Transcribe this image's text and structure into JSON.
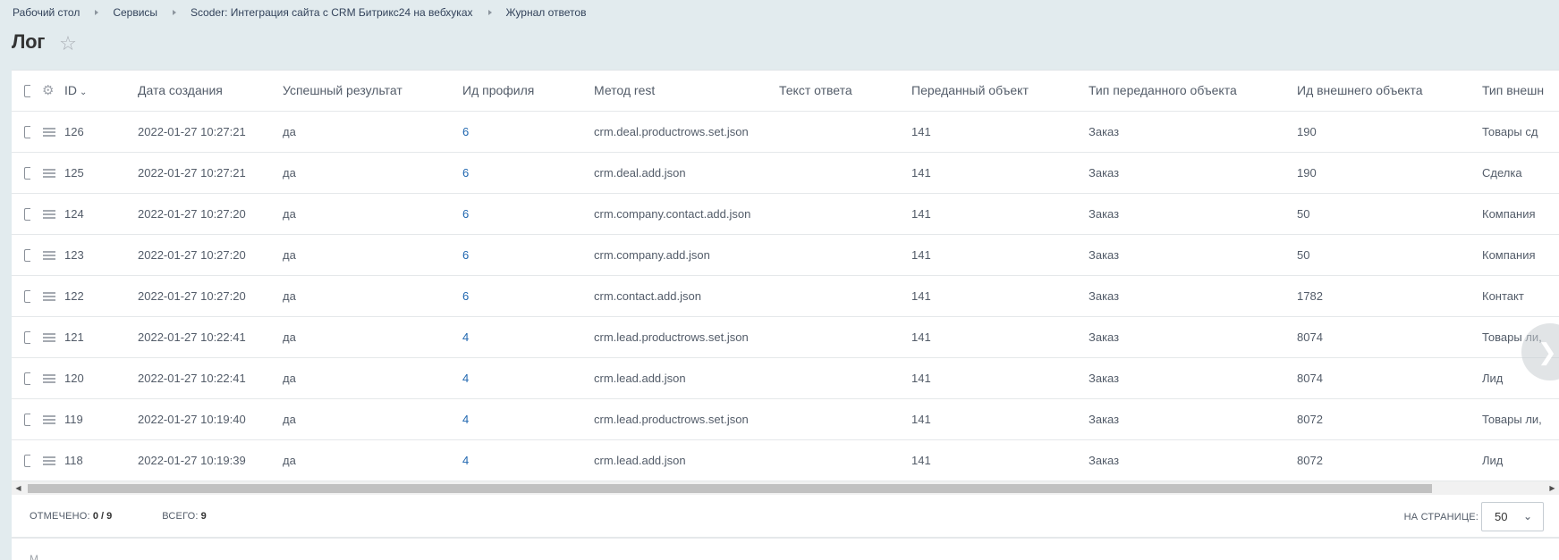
{
  "breadcrumb": [
    "Рабочий стол",
    "Сервисы",
    "Scoder: Интеграция сайта с CRM Битрикс24 на вебхуках",
    "Журнал ответов"
  ],
  "page_title": "Лог",
  "columns": {
    "id": "ID",
    "date": "Дата создания",
    "result": "Успешный результат",
    "profile": "Ид профиля",
    "method": "Метод rest",
    "text": "Текст ответа",
    "object": "Переданный объект",
    "object_type": "Тип переданного объекта",
    "external_id": "Ид внешнего объекта",
    "external_type": "Тип внешн"
  },
  "rows": [
    {
      "id": "126",
      "date": "2022-01-27 10:27:21",
      "result": "да",
      "profile": "6",
      "method": "crm.deal.productrows.set.json",
      "text": "",
      "object": "141",
      "object_type": "Заказ",
      "external_id": "190",
      "external_type": "Товары сд"
    },
    {
      "id": "125",
      "date": "2022-01-27 10:27:21",
      "result": "да",
      "profile": "6",
      "method": "crm.deal.add.json",
      "text": "",
      "object": "141",
      "object_type": "Заказ",
      "external_id": "190",
      "external_type": "Сделка"
    },
    {
      "id": "124",
      "date": "2022-01-27 10:27:20",
      "result": "да",
      "profile": "6",
      "method": "crm.company.contact.add.json",
      "text": "",
      "object": "141",
      "object_type": "Заказ",
      "external_id": "50",
      "external_type": "Компания"
    },
    {
      "id": "123",
      "date": "2022-01-27 10:27:20",
      "result": "да",
      "profile": "6",
      "method": "crm.company.add.json",
      "text": "",
      "object": "141",
      "object_type": "Заказ",
      "external_id": "50",
      "external_type": "Компания"
    },
    {
      "id": "122",
      "date": "2022-01-27 10:27:20",
      "result": "да",
      "profile": "6",
      "method": "crm.contact.add.json",
      "text": "",
      "object": "141",
      "object_type": "Заказ",
      "external_id": "1782",
      "external_type": "Контакт"
    },
    {
      "id": "121",
      "date": "2022-01-27 10:22:41",
      "result": "да",
      "profile": "4",
      "method": "crm.lead.productrows.set.json",
      "text": "",
      "object": "141",
      "object_type": "Заказ",
      "external_id": "8074",
      "external_type": "Товары ли,"
    },
    {
      "id": "120",
      "date": "2022-01-27 10:22:41",
      "result": "да",
      "profile": "4",
      "method": "crm.lead.add.json",
      "text": "",
      "object": "141",
      "object_type": "Заказ",
      "external_id": "8074",
      "external_type": "Лид"
    },
    {
      "id": "119",
      "date": "2022-01-27 10:19:40",
      "result": "да",
      "profile": "4",
      "method": "crm.lead.productrows.set.json",
      "text": "",
      "object": "141",
      "object_type": "Заказ",
      "external_id": "8072",
      "external_type": "Товары ли,"
    },
    {
      "id": "118",
      "date": "2022-01-27 10:19:39",
      "result": "да",
      "profile": "4",
      "method": "crm.lead.add.json",
      "text": "",
      "object": "141",
      "object_type": "Заказ",
      "external_id": "8072",
      "external_type": "Лид"
    }
  ],
  "footer": {
    "checked_label": "Отмечено:",
    "checked_value": "0 / 9",
    "total_label": "Всего:",
    "total_value": "9",
    "per_page_label": "На странице:",
    "per_page_value": "50"
  },
  "below_stub": "М",
  "colors": {
    "background": "#e2ebee",
    "link": "#2067b0",
    "text": "#535c69"
  },
  "icons": {
    "settings": "gear-icon",
    "favorite": "star-icon",
    "sort": "chevron-down-icon",
    "next": "chevron-right-icon"
  }
}
